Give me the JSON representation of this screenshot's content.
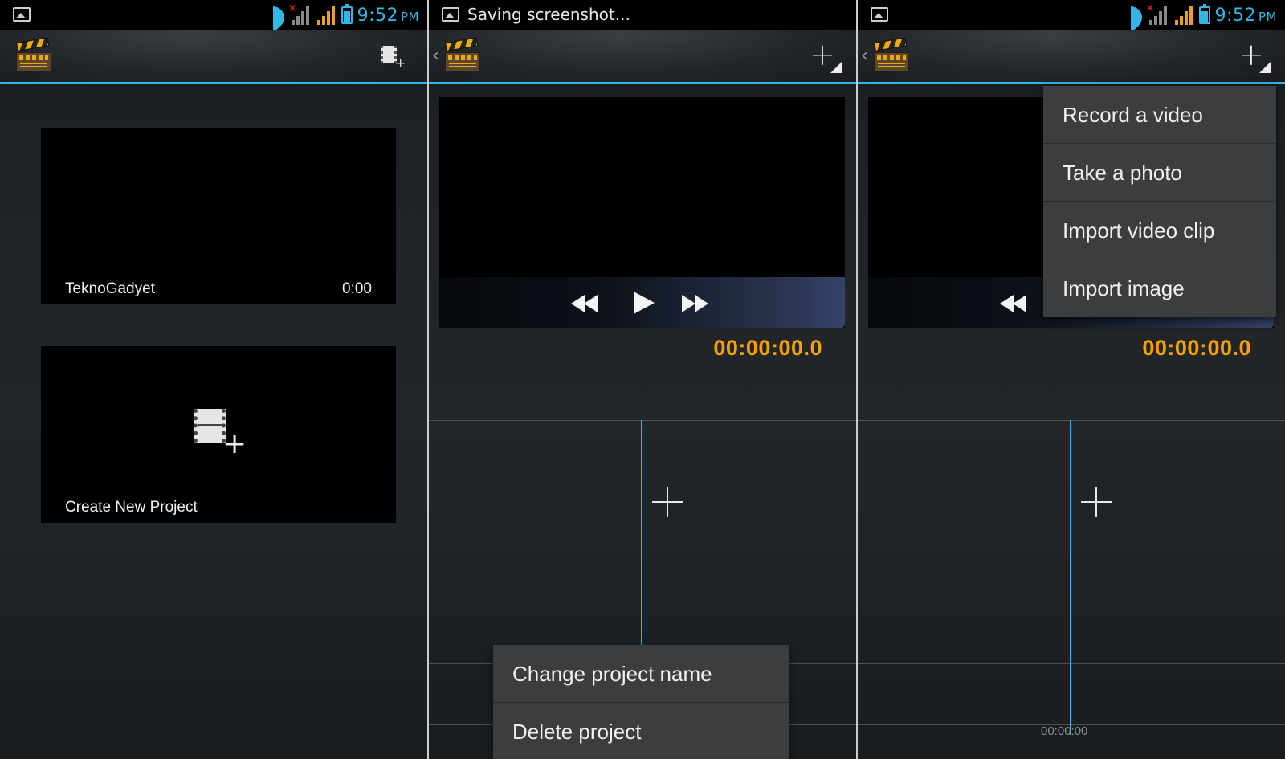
{
  "status_bar": {
    "time": "9:52",
    "ampm": "PM",
    "notification": "Saving screenshot..."
  },
  "panel1": {
    "projects": [
      {
        "name": "TeknoGadyet",
        "duration": "0:00"
      }
    ],
    "create_label": "Create New Project"
  },
  "panel2": {
    "timecode": "00:00:00.0",
    "context_menu": [
      "Change project name",
      "Delete project"
    ]
  },
  "panel3": {
    "timecode": "00:00:00.0",
    "add_menu": [
      "Record a video",
      "Take a photo",
      "Import video clip",
      "Import image"
    ],
    "timeline_start": "00:00:00"
  },
  "colors": {
    "accent": "#33b5e5",
    "timecode": "#f5a200"
  }
}
